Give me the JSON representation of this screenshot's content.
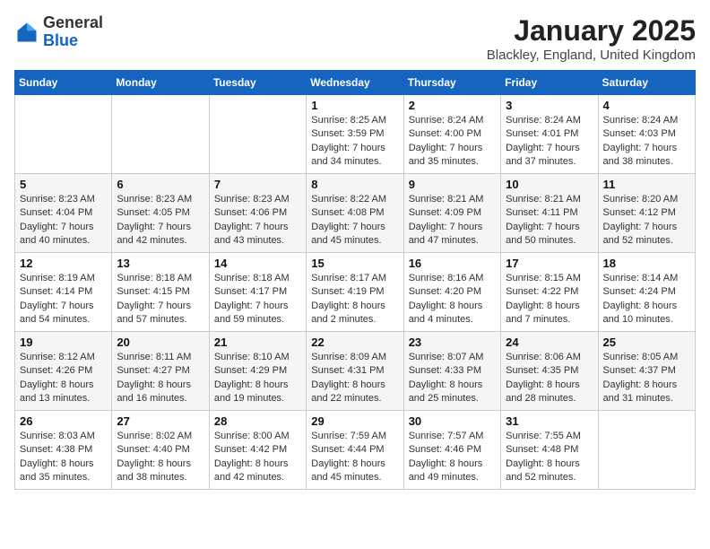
{
  "logo": {
    "general": "General",
    "blue": "Blue"
  },
  "header": {
    "title": "January 2025",
    "subtitle": "Blackley, England, United Kingdom"
  },
  "weekdays": [
    "Sunday",
    "Monday",
    "Tuesday",
    "Wednesday",
    "Thursday",
    "Friday",
    "Saturday"
  ],
  "weeks": [
    [
      {
        "day": "",
        "sunrise": "",
        "sunset": "",
        "daylight": ""
      },
      {
        "day": "",
        "sunrise": "",
        "sunset": "",
        "daylight": ""
      },
      {
        "day": "",
        "sunrise": "",
        "sunset": "",
        "daylight": ""
      },
      {
        "day": "1",
        "sunrise": "Sunrise: 8:25 AM",
        "sunset": "Sunset: 3:59 PM",
        "daylight": "Daylight: 7 hours and 34 minutes."
      },
      {
        "day": "2",
        "sunrise": "Sunrise: 8:24 AM",
        "sunset": "Sunset: 4:00 PM",
        "daylight": "Daylight: 7 hours and 35 minutes."
      },
      {
        "day": "3",
        "sunrise": "Sunrise: 8:24 AM",
        "sunset": "Sunset: 4:01 PM",
        "daylight": "Daylight: 7 hours and 37 minutes."
      },
      {
        "day": "4",
        "sunrise": "Sunrise: 8:24 AM",
        "sunset": "Sunset: 4:03 PM",
        "daylight": "Daylight: 7 hours and 38 minutes."
      }
    ],
    [
      {
        "day": "5",
        "sunrise": "Sunrise: 8:23 AM",
        "sunset": "Sunset: 4:04 PM",
        "daylight": "Daylight: 7 hours and 40 minutes."
      },
      {
        "day": "6",
        "sunrise": "Sunrise: 8:23 AM",
        "sunset": "Sunset: 4:05 PM",
        "daylight": "Daylight: 7 hours and 42 minutes."
      },
      {
        "day": "7",
        "sunrise": "Sunrise: 8:23 AM",
        "sunset": "Sunset: 4:06 PM",
        "daylight": "Daylight: 7 hours and 43 minutes."
      },
      {
        "day": "8",
        "sunrise": "Sunrise: 8:22 AM",
        "sunset": "Sunset: 4:08 PM",
        "daylight": "Daylight: 7 hours and 45 minutes."
      },
      {
        "day": "9",
        "sunrise": "Sunrise: 8:21 AM",
        "sunset": "Sunset: 4:09 PM",
        "daylight": "Daylight: 7 hours and 47 minutes."
      },
      {
        "day": "10",
        "sunrise": "Sunrise: 8:21 AM",
        "sunset": "Sunset: 4:11 PM",
        "daylight": "Daylight: 7 hours and 50 minutes."
      },
      {
        "day": "11",
        "sunrise": "Sunrise: 8:20 AM",
        "sunset": "Sunset: 4:12 PM",
        "daylight": "Daylight: 7 hours and 52 minutes."
      }
    ],
    [
      {
        "day": "12",
        "sunrise": "Sunrise: 8:19 AM",
        "sunset": "Sunset: 4:14 PM",
        "daylight": "Daylight: 7 hours and 54 minutes."
      },
      {
        "day": "13",
        "sunrise": "Sunrise: 8:18 AM",
        "sunset": "Sunset: 4:15 PM",
        "daylight": "Daylight: 7 hours and 57 minutes."
      },
      {
        "day": "14",
        "sunrise": "Sunrise: 8:18 AM",
        "sunset": "Sunset: 4:17 PM",
        "daylight": "Daylight: 7 hours and 59 minutes."
      },
      {
        "day": "15",
        "sunrise": "Sunrise: 8:17 AM",
        "sunset": "Sunset: 4:19 PM",
        "daylight": "Daylight: 8 hours and 2 minutes."
      },
      {
        "day": "16",
        "sunrise": "Sunrise: 8:16 AM",
        "sunset": "Sunset: 4:20 PM",
        "daylight": "Daylight: 8 hours and 4 minutes."
      },
      {
        "day": "17",
        "sunrise": "Sunrise: 8:15 AM",
        "sunset": "Sunset: 4:22 PM",
        "daylight": "Daylight: 8 hours and 7 minutes."
      },
      {
        "day": "18",
        "sunrise": "Sunrise: 8:14 AM",
        "sunset": "Sunset: 4:24 PM",
        "daylight": "Daylight: 8 hours and 10 minutes."
      }
    ],
    [
      {
        "day": "19",
        "sunrise": "Sunrise: 8:12 AM",
        "sunset": "Sunset: 4:26 PM",
        "daylight": "Daylight: 8 hours and 13 minutes."
      },
      {
        "day": "20",
        "sunrise": "Sunrise: 8:11 AM",
        "sunset": "Sunset: 4:27 PM",
        "daylight": "Daylight: 8 hours and 16 minutes."
      },
      {
        "day": "21",
        "sunrise": "Sunrise: 8:10 AM",
        "sunset": "Sunset: 4:29 PM",
        "daylight": "Daylight: 8 hours and 19 minutes."
      },
      {
        "day": "22",
        "sunrise": "Sunrise: 8:09 AM",
        "sunset": "Sunset: 4:31 PM",
        "daylight": "Daylight: 8 hours and 22 minutes."
      },
      {
        "day": "23",
        "sunrise": "Sunrise: 8:07 AM",
        "sunset": "Sunset: 4:33 PM",
        "daylight": "Daylight: 8 hours and 25 minutes."
      },
      {
        "day": "24",
        "sunrise": "Sunrise: 8:06 AM",
        "sunset": "Sunset: 4:35 PM",
        "daylight": "Daylight: 8 hours and 28 minutes."
      },
      {
        "day": "25",
        "sunrise": "Sunrise: 8:05 AM",
        "sunset": "Sunset: 4:37 PM",
        "daylight": "Daylight: 8 hours and 31 minutes."
      }
    ],
    [
      {
        "day": "26",
        "sunrise": "Sunrise: 8:03 AM",
        "sunset": "Sunset: 4:38 PM",
        "daylight": "Daylight: 8 hours and 35 minutes."
      },
      {
        "day": "27",
        "sunrise": "Sunrise: 8:02 AM",
        "sunset": "Sunset: 4:40 PM",
        "daylight": "Daylight: 8 hours and 38 minutes."
      },
      {
        "day": "28",
        "sunrise": "Sunrise: 8:00 AM",
        "sunset": "Sunset: 4:42 PM",
        "daylight": "Daylight: 8 hours and 42 minutes."
      },
      {
        "day": "29",
        "sunrise": "Sunrise: 7:59 AM",
        "sunset": "Sunset: 4:44 PM",
        "daylight": "Daylight: 8 hours and 45 minutes."
      },
      {
        "day": "30",
        "sunrise": "Sunrise: 7:57 AM",
        "sunset": "Sunset: 4:46 PM",
        "daylight": "Daylight: 8 hours and 49 minutes."
      },
      {
        "day": "31",
        "sunrise": "Sunrise: 7:55 AM",
        "sunset": "Sunset: 4:48 PM",
        "daylight": "Daylight: 8 hours and 52 minutes."
      },
      {
        "day": "",
        "sunrise": "",
        "sunset": "",
        "daylight": ""
      }
    ]
  ]
}
